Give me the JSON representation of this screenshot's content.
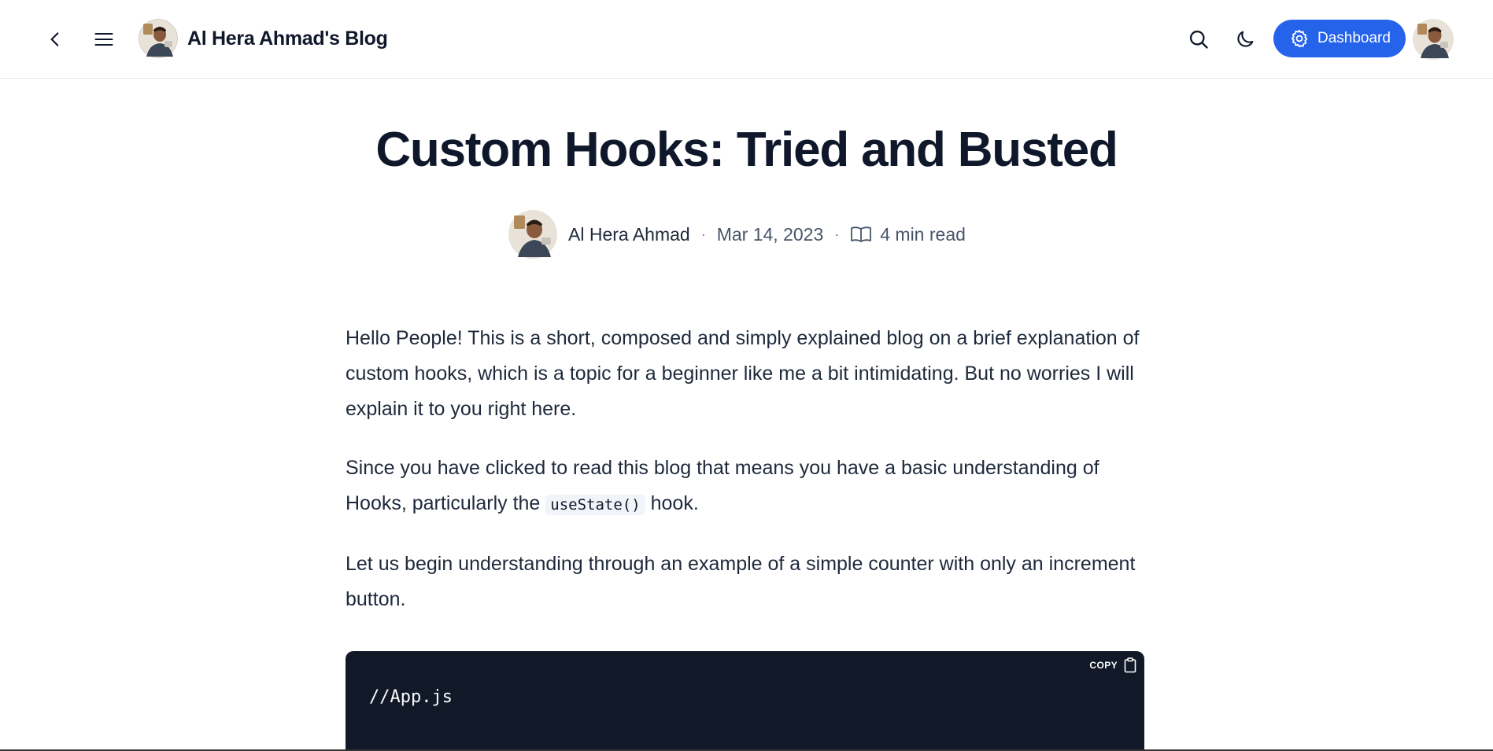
{
  "header": {
    "blog_title": "Al Hera Ahmad's Blog",
    "dashboard_label": "Dashboard",
    "icons": [
      "chevron-left-icon",
      "menu-icon",
      "search-icon",
      "moon-icon",
      "gear-icon"
    ],
    "accent_color": "#2563eb"
  },
  "article": {
    "title": "Custom Hooks: Tried and Busted",
    "author": "Al Hera Ahmad",
    "date": "Mar 14, 2023",
    "read_time": "4 min read",
    "separator": "·",
    "paragraphs": {
      "p1": "Hello People! This is a short, composed and simply explained blog on a brief explanation of custom hooks, which is a topic for a beginner like me a bit intimidating. But no worries I will explain it to you right here.",
      "p2_before": "Since you have clicked to read this blog that means you have a basic understanding of Hooks, particularly the ",
      "p2_code": "useState()",
      "p2_after": " hook.",
      "p3": "Let us begin understanding through an example of a simple counter with only an increment button."
    },
    "code_block": {
      "copy_label": "COPY",
      "first_line": "//App.js",
      "background": "#111827"
    }
  }
}
